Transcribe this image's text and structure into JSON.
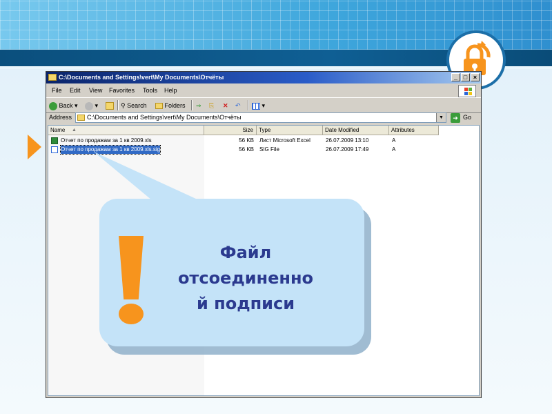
{
  "window": {
    "title": "C:\\Documents and Settings\\vert\\My Documents\\Отчёты",
    "controls": {
      "minimize": "_",
      "maximize": "□",
      "close": "×"
    }
  },
  "menu": [
    "File",
    "Edit",
    "View",
    "Favorites",
    "Tools",
    "Help"
  ],
  "toolbar": {
    "back": "Back",
    "search": "Search",
    "folders": "Folders"
  },
  "address": {
    "label": "Address",
    "value": "C:\\Documents and Settings\\vert\\My Documents\\Отчёты",
    "go": "Go"
  },
  "columns": [
    "Name",
    "Size",
    "Type",
    "Date Modified",
    "Attributes"
  ],
  "files": [
    {
      "name": "Отчет по продажам за 1 кв 2009.xls",
      "size": "56 KB",
      "type": "Лист Microsoft Excel",
      "date": "26.07.2009 13:10",
      "attr": "A",
      "icon": "excel-file-icon",
      "selected": false
    },
    {
      "name": "Отчет по продажам за 1 кв 2009.xls.sig",
      "size": "56 KB",
      "type": "SIG File",
      "date": "26.07.2009 17:49",
      "attr": "A",
      "icon": "sig-file-icon",
      "selected": true
    }
  ],
  "callout": {
    "lines": [
      "Файл",
      "отсоединенно",
      "й подписи"
    ]
  },
  "colors": {
    "accent_orange": "#f7941d",
    "callout_bg": "#c4e3f8",
    "callout_text": "#2b3a8f",
    "title_bar": "#0a246a",
    "selection": "#316ac5"
  },
  "icons": {
    "lock": "lock-icon",
    "arrow": "orange-arrow-marker",
    "exclamation": "exclamation-icon"
  }
}
